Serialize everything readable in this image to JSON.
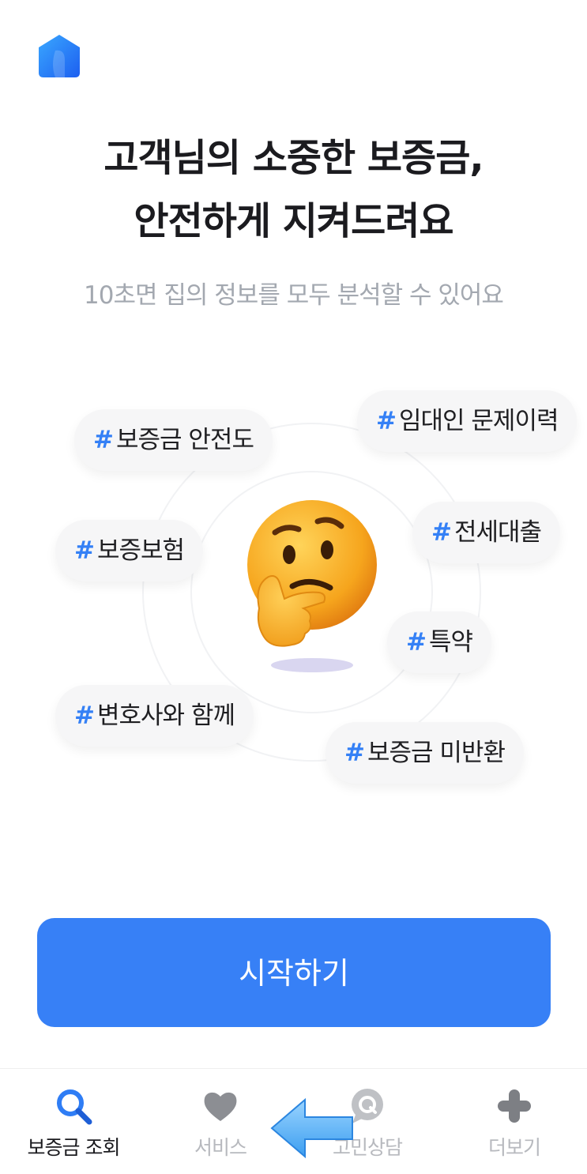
{
  "headline": {
    "line1": "고객님의 소중한 보증금,",
    "line2": "안전하게 지켜드려요"
  },
  "subtitle": "10초면 집의 정보를 모두 분석할 수 있어요",
  "tags": {
    "hash": "#",
    "items": [
      "보증금 안전도",
      "임대인 문제이력",
      "보증보험",
      "전세대출",
      "특약",
      "변호사와 함께",
      "보증금 미반환"
    ]
  },
  "emoji": "thinking-face",
  "cta": {
    "label": "시작하기"
  },
  "tabbar": {
    "tabs": [
      {
        "label": "보증금 조회",
        "icon": "search-icon",
        "active": true
      },
      {
        "label": "서비스",
        "icon": "heart-icon",
        "active": false
      },
      {
        "label": "고민상담",
        "icon": "chat-q-icon",
        "active": false
      },
      {
        "label": "더보기",
        "icon": "plus-icon",
        "active": false
      }
    ]
  },
  "colors": {
    "accent": "#3780f6",
    "hash": "#3480f6",
    "inactive": "#b7b9be"
  }
}
